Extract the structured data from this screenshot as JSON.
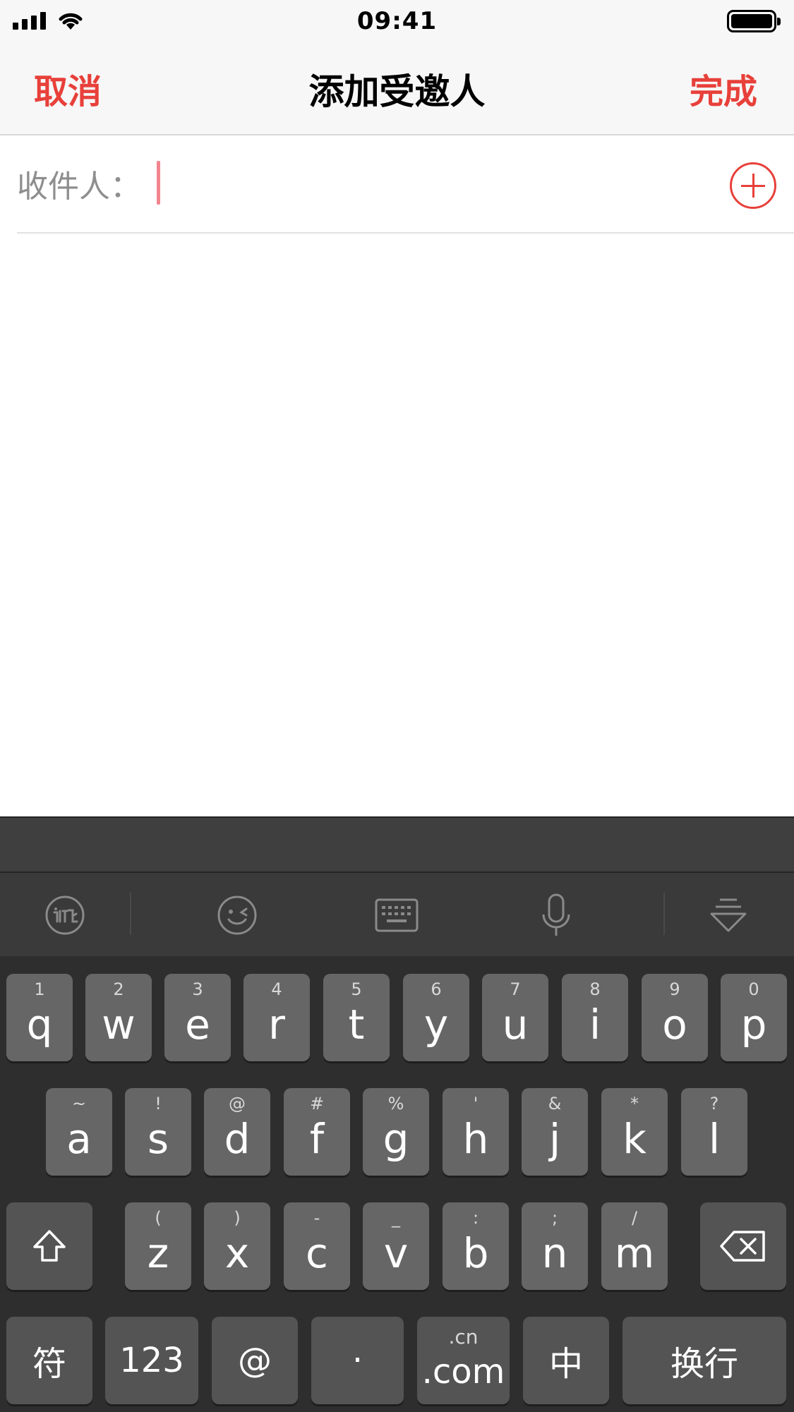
{
  "status_bar": {
    "time": "09:41"
  },
  "nav": {
    "cancel": "取消",
    "title": "添加受邀人",
    "done": "完成"
  },
  "recipient": {
    "label": "收件人：",
    "value": "",
    "placeholder": ""
  },
  "keyboard": {
    "toolbar": [
      "iflytek-logo-icon",
      "emoji-icon",
      "keyboard-icon",
      "microphone-icon",
      "hide-keyboard-icon"
    ],
    "row1": [
      {
        "key": "q",
        "sub": "1"
      },
      {
        "key": "w",
        "sub": "2"
      },
      {
        "key": "e",
        "sub": "3"
      },
      {
        "key": "r",
        "sub": "4"
      },
      {
        "key": "t",
        "sub": "5"
      },
      {
        "key": "y",
        "sub": "6"
      },
      {
        "key": "u",
        "sub": "7"
      },
      {
        "key": "i",
        "sub": "8"
      },
      {
        "key": "o",
        "sub": "9"
      },
      {
        "key": "p",
        "sub": "0"
      }
    ],
    "row2": [
      {
        "key": "a",
        "sub": "~"
      },
      {
        "key": "s",
        "sub": "!"
      },
      {
        "key": "d",
        "sub": "@"
      },
      {
        "key": "f",
        "sub": "#"
      },
      {
        "key": "g",
        "sub": "%"
      },
      {
        "key": "h",
        "sub": "'"
      },
      {
        "key": "j",
        "sub": "&"
      },
      {
        "key": "k",
        "sub": "*"
      },
      {
        "key": "l",
        "sub": "?"
      }
    ],
    "row3": [
      {
        "key": "z",
        "sub": "("
      },
      {
        "key": "x",
        "sub": ")"
      },
      {
        "key": "c",
        "sub": "-"
      },
      {
        "key": "v",
        "sub": "_"
      },
      {
        "key": "b",
        "sub": ":"
      },
      {
        "key": "n",
        "sub": ";"
      },
      {
        "key": "m",
        "sub": "/"
      }
    ],
    "bottom": {
      "symbols": "符",
      "numbers": "123",
      "at": "@",
      "dot": "·",
      "com_top": ".cn",
      "com": ".com",
      "chinese": "中",
      "return": "换行"
    }
  }
}
